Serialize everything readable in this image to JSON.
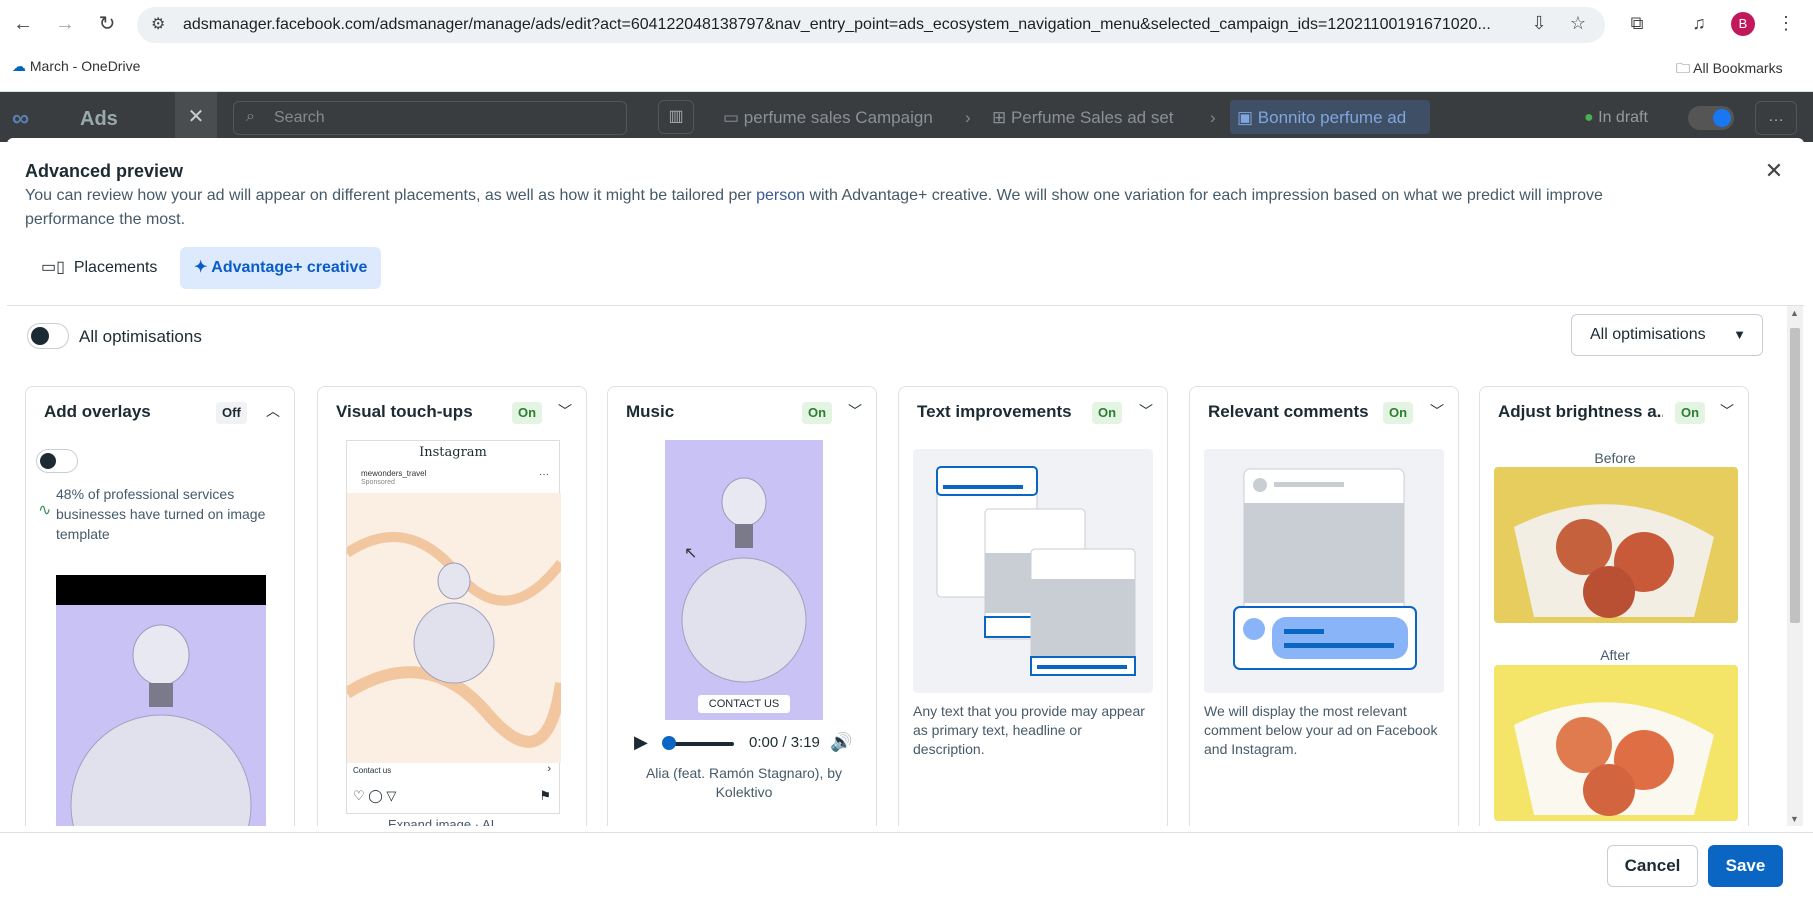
{
  "browser": {
    "url": "adsmanager.facebook.com/adsmanager/manage/ads/edit?act=604122048138797&nav_entry_point=ads_ecosystem_navigation_menu&selected_campaign_ids=12021100191671020...",
    "profile_initial": "B",
    "bookmark_onedrive": "March - OneDrive",
    "bookmark_all": "All Bookmarks"
  },
  "appbar": {
    "brand": "Ads",
    "search_placeholder": "Search",
    "breadcrumb": [
      "perfume sales Campaign",
      "Perfume Sales ad set",
      "Bonnito perfume ad"
    ],
    "status": "In draft"
  },
  "modal": {
    "title": "Advanced preview",
    "description_before": "You can review how your ad will appear on different placements, as well as how it might be tailored per ",
    "description_link": "person",
    "description_after": " with Advantage+ creative. We will show one variation for each impression based on what we predict will improve performance the most.",
    "tabs": [
      {
        "label": "Placements",
        "active": false
      },
      {
        "label": "Advantage+ creative",
        "active": true
      }
    ],
    "all_optimisations_toggle_label": "All optimisations",
    "all_optimisations_dropdown": "All optimisations"
  },
  "cards": [
    {
      "title": "Add overlays",
      "status": "Off",
      "stat": "48% of professional services businesses have turned on image template"
    },
    {
      "title": "Visual touch-ups",
      "status": "On",
      "ig_brand": "Instagram",
      "ig_handle": "mewonders_travel",
      "ig_sponsored": "Sponsored",
      "ig_cta": "Contact us",
      "below_text": "Expand image · AI"
    },
    {
      "title": "Music",
      "status": "On",
      "cta": "CONTACT US",
      "time": "0:00 / 3:19",
      "song": "Alia (feat. Ramón Stagnaro), by Kolektivo"
    },
    {
      "title": "Text improvements",
      "status": "On",
      "description": "Any text that you provide may appear as primary text, headline or description."
    },
    {
      "title": "Relevant comments",
      "status": "On",
      "description": "We will display the most relevant comment below your ad on Facebook and Instagram."
    },
    {
      "title": "Adjust brightness a...",
      "status": "On",
      "before_label": "Before",
      "after_label": "After"
    }
  ],
  "footer": {
    "cancel_label": "Cancel",
    "save_label": "Save"
  },
  "colors": {
    "accent": "#0a66c2",
    "on_badge": "#2e7d32",
    "preview_purple": "#c9c2f4"
  }
}
